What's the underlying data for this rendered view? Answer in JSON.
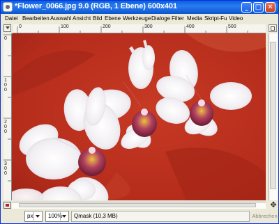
{
  "window": {
    "title": "*Flower_0066.jpg 9.0 (RGB, 1 Ebene) 600x401",
    "app_icon": "gimp-wilber-icon",
    "buttons": {
      "minimize": "_",
      "maximize": "□",
      "close": "✕"
    }
  },
  "menu": [
    {
      "label": "Datei"
    },
    {
      "label": "Bearbeiten"
    },
    {
      "label": "Auswahl"
    },
    {
      "label": "Ansicht"
    },
    {
      "label": "Bild"
    },
    {
      "label": "Ebene"
    },
    {
      "label": "Werkzeuge"
    },
    {
      "label": "Dialoge"
    },
    {
      "label": "Filter"
    },
    {
      "label": "Media"
    },
    {
      "label": "Skript-Fu"
    },
    {
      "label": "Video"
    }
  ],
  "rulers": {
    "horizontal": [
      "0",
      "100",
      "200",
      "300",
      "400",
      "500"
    ],
    "vertical": [
      "0",
      "100",
      "200",
      "300"
    ]
  },
  "statusbar": {
    "unit": "px",
    "zoom": "100%",
    "message": "Qmask (10,3 MB)",
    "cancel": "Abbrechen"
  },
  "colors": {
    "titlebar": "#0b55d0",
    "quickmask_tint": "#b42a1a",
    "window_bg": "#ece9d8"
  },
  "icons": {
    "menu_corner": "triangle-menu-icon",
    "navigate": "navigate-icon",
    "quickmask": "quickmask-toggle-icon",
    "move": "move-arrows-icon"
  }
}
